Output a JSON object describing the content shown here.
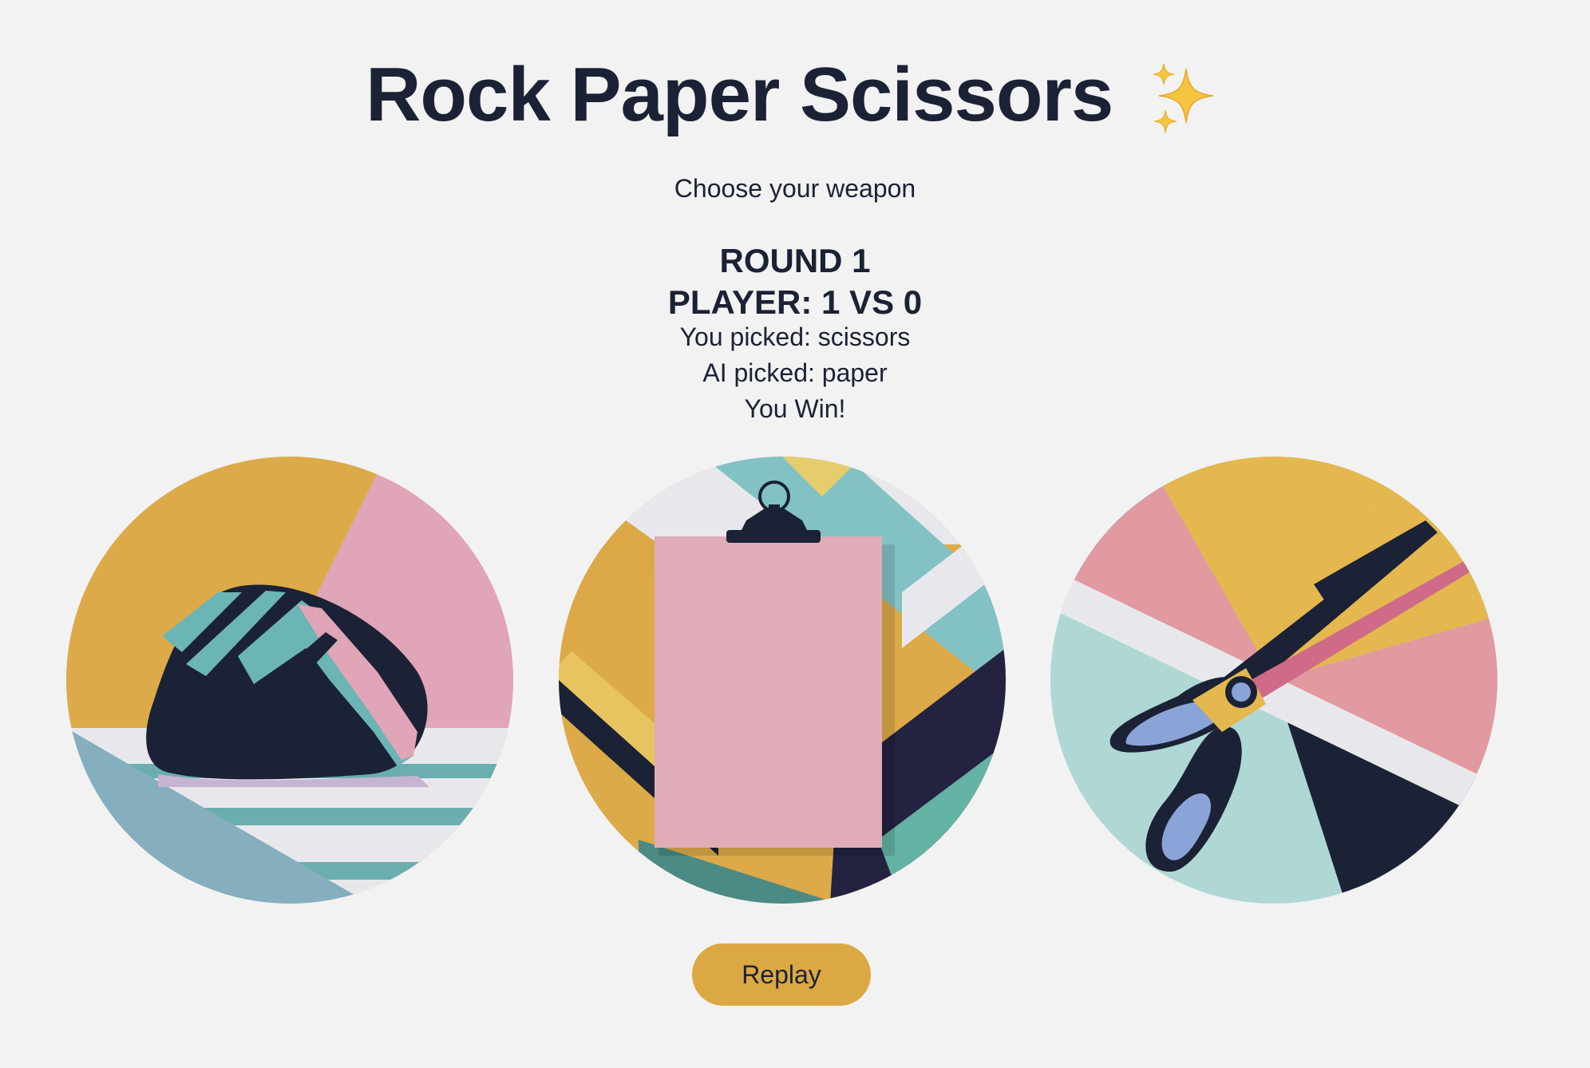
{
  "header": {
    "title": "Rock Paper Scissors",
    "sparkle_icon": "sparkles-emoji",
    "subtitle": "Choose your weapon"
  },
  "status": {
    "round": "ROUND 1",
    "score": "PLAYER: 1 VS 0",
    "you_picked": "You picked: scissors",
    "ai_picked": "AI picked: paper",
    "result": "You Win!"
  },
  "choices": [
    {
      "id": "rock",
      "icon": "rock-illustration"
    },
    {
      "id": "paper",
      "icon": "paper-clipboard-illustration"
    },
    {
      "id": "scissors",
      "icon": "scissors-illustration"
    }
  ],
  "actions": {
    "replay_label": "Replay"
  },
  "colors": {
    "background": "#f2f2f2",
    "text": "#1b2235",
    "accent": "#dba843",
    "pink": "#e0a5b6",
    "teal": "#6bb6b4",
    "navy": "#1b2235"
  }
}
